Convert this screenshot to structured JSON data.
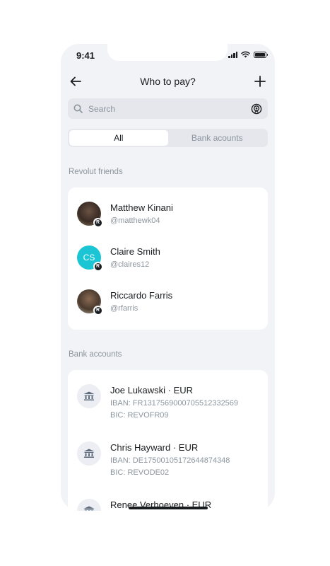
{
  "status_bar": {
    "time": "9:41"
  },
  "header": {
    "title": "Who to pay?"
  },
  "search": {
    "placeholder": "Search"
  },
  "tabs": [
    {
      "label": "All",
      "active": true
    },
    {
      "label": "Bank acounts",
      "active": false
    }
  ],
  "friends_section": {
    "label": "Revolut friends",
    "items": [
      {
        "name": "Matthew Kinani",
        "handle": "@matthewk04",
        "avatar": "photo",
        "badge": "R"
      },
      {
        "name": "Claire Smith",
        "handle": "@claires12",
        "avatar": "initials",
        "initials": "CS",
        "badge": "R"
      },
      {
        "name": "Riccardo Farris",
        "handle": "@rfarris",
        "avatar": "photo",
        "badge": "R"
      }
    ]
  },
  "bank_section": {
    "label": "Bank accounts",
    "items": [
      {
        "name": "Joe Lukawski · EUR",
        "iban": "IBAN: FR1317569000705512332569",
        "bic": "BIC: REVOFR09"
      },
      {
        "name": "Chris Hayward · EUR",
        "iban": "IBAN: DE17500105172644874348",
        "bic": "BIC: REVODE02"
      },
      {
        "name": "Renee Verhoeven · EUR"
      }
    ]
  },
  "colors": {
    "accent_teal": "#1bc5d4",
    "background": "#f2f3f6",
    "text_primary": "#191c1f",
    "text_secondary": "#8b959e"
  },
  "icons": [
    "back-arrow-icon",
    "plus-icon",
    "search-icon",
    "radar-icon",
    "bank-icon",
    "revolut-badge-icon",
    "signal-icon",
    "wifi-icon",
    "battery-icon"
  ]
}
